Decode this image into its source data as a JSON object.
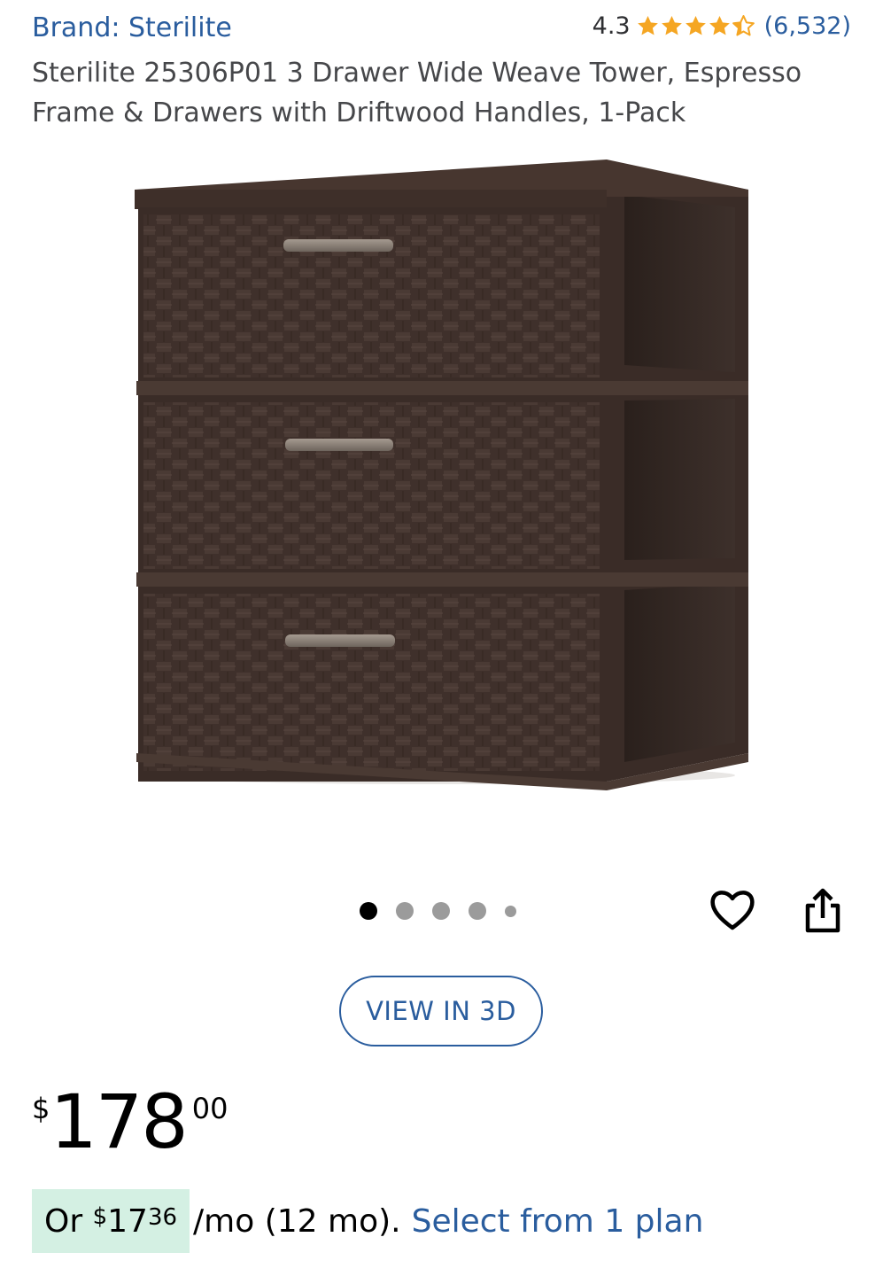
{
  "brand": {
    "label": "Brand: Sterilite"
  },
  "rating": {
    "value": "4.3",
    "stars": 4.3,
    "count": "(6,532)",
    "star_color": "#f5a623"
  },
  "product": {
    "title": "Sterilite 25306P01 3 Drawer Wide Weave Tower, Espresso Frame & Drawers with Driftwood Handles, 1-Pack"
  },
  "gallery": {
    "image_icon": "drawer-tower-image",
    "dot_count": 5,
    "active_index": 0
  },
  "actions": {
    "favorite_icon": "heart-outline-icon",
    "share_icon": "share-icon"
  },
  "view3d": {
    "label": "VIEW IN 3D"
  },
  "price": {
    "currency": "$",
    "whole": "178",
    "cents": "00"
  },
  "installment": {
    "prefix": "Or",
    "currency": "$",
    "whole": "17",
    "cents": "36",
    "suffix": "/mo (12 mo).",
    "link": "Select from 1 plan",
    "highlight_color": "#d4f0e3"
  },
  "colors": {
    "link": "#2a5d9e",
    "text": "#2e2f32"
  }
}
